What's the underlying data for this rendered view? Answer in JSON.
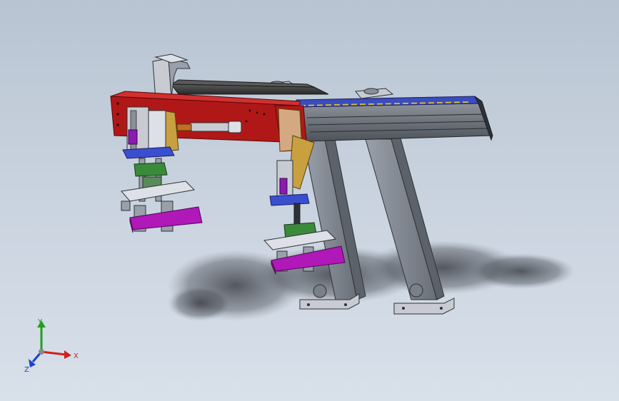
{
  "scene": {
    "colors": {
      "background_top": "#b8c4d2",
      "background_bottom": "#d8e0ea",
      "red_plate": "#b01818",
      "dark_beam": "#3c3c3c",
      "gray_steel": "#9aa0aa",
      "light_steel": "#c8cbd2",
      "blue_plate": "#3a4fd0",
      "green_part": "#3a8a3a",
      "purple_block": "#b018b8",
      "gold_part": "#c8a040",
      "shadow": "#5a5f66"
    }
  },
  "triad": {
    "x_label": "X",
    "y_label": "Y",
    "z_label": "Z",
    "x_color": "#d02020",
    "y_color": "#20a020",
    "z_color": "#2040d0"
  }
}
